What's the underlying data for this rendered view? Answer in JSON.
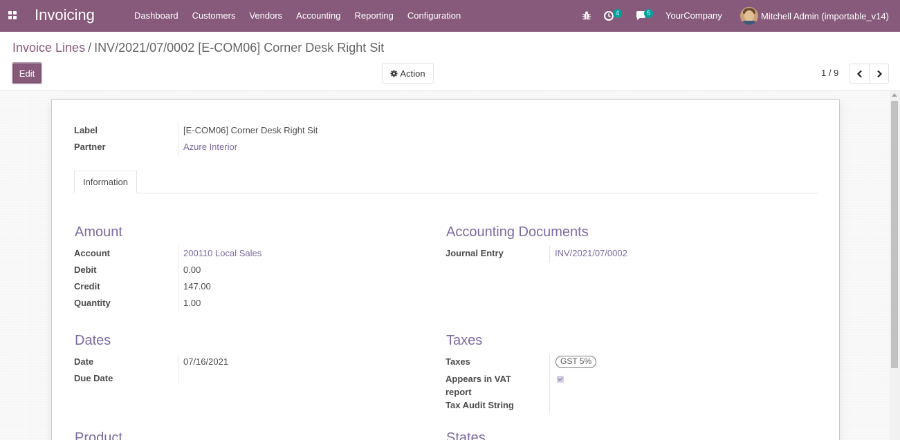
{
  "navbar": {
    "app_name": "Invoicing",
    "menu": [
      "Dashboard",
      "Customers",
      "Vendors",
      "Accounting",
      "Reporting",
      "Configuration"
    ],
    "activity_count": "4",
    "message_count": "5",
    "company": "YourCompany",
    "user": "Mitchell Admin (importable_v14)",
    "brand_color": "#875a7b"
  },
  "breadcrumb": {
    "parent": "Invoice Lines",
    "separator": "/",
    "current": "INV/2021/07/0002 [E-COM06] Corner Desk Right Sit"
  },
  "control": {
    "edit_label": "Edit",
    "action_label": "Action",
    "pager": "1 / 9"
  },
  "header_fields": {
    "label_label": "Label",
    "label_value": "[E-COM06] Corner Desk Right Sit",
    "partner_label": "Partner",
    "partner_value": "Azure Interior"
  },
  "tabs": [
    "Information"
  ],
  "amount": {
    "title": "Amount",
    "account_label": "Account",
    "account_value": "200110 Local Sales",
    "debit_label": "Debit",
    "debit_value": "0.00",
    "credit_label": "Credit",
    "credit_value": "147.00",
    "quantity_label": "Quantity",
    "quantity_value": "1.00"
  },
  "accounting_documents": {
    "title": "Accounting Documents",
    "journal_entry_label": "Journal Entry",
    "journal_entry_value": "INV/2021/07/0002"
  },
  "dates": {
    "title": "Dates",
    "date_label": "Date",
    "date_value": "07/16/2021",
    "due_date_label": "Due Date",
    "due_date_value": ""
  },
  "taxes": {
    "title": "Taxes",
    "taxes_label": "Taxes",
    "tax_tag": "GST 5%",
    "vat_label_line1": "Appears in VAT",
    "vat_label_line2": "report",
    "vat_checked": true,
    "audit_label": "Tax Audit String"
  },
  "next_groups": {
    "product_title": "Product",
    "states_title": "States"
  }
}
